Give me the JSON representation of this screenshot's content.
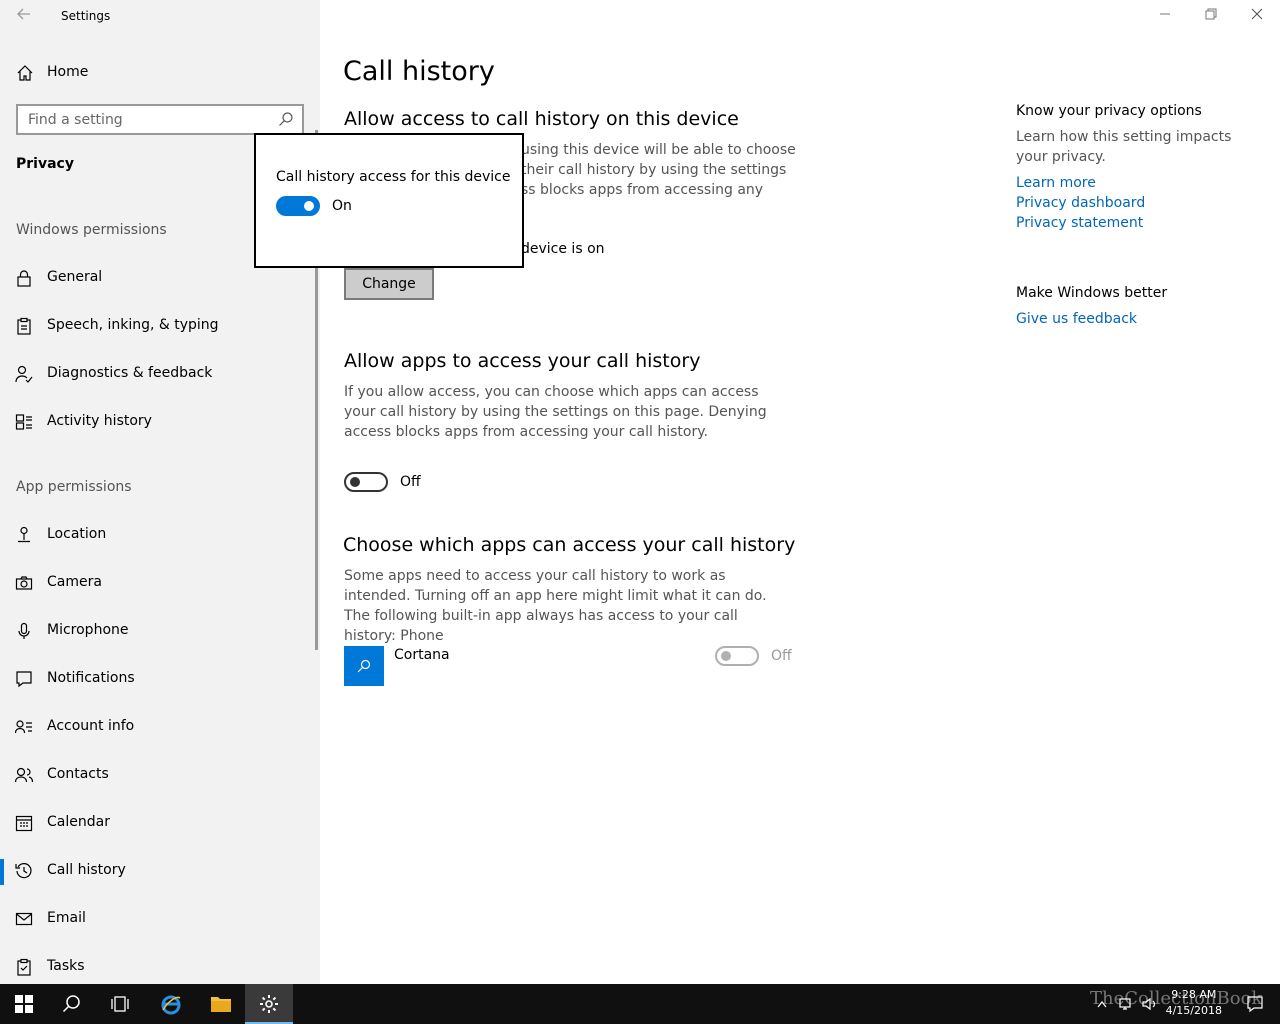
{
  "window": {
    "title": "Settings",
    "back_icon": "back-arrow-icon",
    "controls": [
      "minimize-icon",
      "maximize-icon",
      "close-icon"
    ]
  },
  "sidebar": {
    "home_label": "Home",
    "search_placeholder": "Find a setting",
    "section_title": "Privacy",
    "windows_permissions_label": "Windows permissions",
    "windows_permissions": [
      {
        "label": "General",
        "icon": "lock-icon"
      },
      {
        "label": "Speech, inking, & typing",
        "icon": "clipboard-icon"
      },
      {
        "label": "Diagnostics & feedback",
        "icon": "person-feedback-icon"
      },
      {
        "label": "Activity history",
        "icon": "activity-history-icon"
      }
    ],
    "app_permissions_label": "App permissions",
    "app_permissions": [
      {
        "label": "Location",
        "icon": "location-icon"
      },
      {
        "label": "Camera",
        "icon": "camera-icon"
      },
      {
        "label": "Microphone",
        "icon": "microphone-icon"
      },
      {
        "label": "Notifications",
        "icon": "notification-icon"
      },
      {
        "label": "Account info",
        "icon": "account-info-icon"
      },
      {
        "label": "Contacts",
        "icon": "contacts-icon"
      },
      {
        "label": "Calendar",
        "icon": "calendar-icon"
      },
      {
        "label": "Call history",
        "icon": "call-history-icon",
        "active": true
      },
      {
        "label": "Email",
        "icon": "email-icon"
      },
      {
        "label": "Tasks",
        "icon": "tasks-icon"
      }
    ]
  },
  "main": {
    "page_title": "Call history",
    "section1": {
      "heading": "Allow access to call history on this device",
      "body_visible": [
        "using this device will be able to choose",
        "their call history by using the settings",
        "ss blocks apps from accessing any"
      ],
      "status_visible": "device is on",
      "change_button": "Change"
    },
    "section2": {
      "heading": "Allow apps to access your call history",
      "body": "If you allow access, you can choose which apps can access your call history by using the settings on this page. Denying access blocks apps from accessing your call history.",
      "toggle_state": "Off"
    },
    "section3": {
      "heading": "Choose which apps can access your call history",
      "body": "Some apps need to access your call history to work as intended. Turning off an app here might limit what it can do. The following built-in app always has access to your call history: Phone",
      "apps": [
        {
          "name": "Cortana",
          "toggle_state": "Off",
          "icon": "cortana-search-icon"
        }
      ]
    }
  },
  "right_panel": {
    "privacy_heading": "Know your privacy options",
    "privacy_text": "Learn how this setting impacts your privacy.",
    "links": [
      "Learn more",
      "Privacy dashboard",
      "Privacy statement"
    ],
    "feedback_heading": "Make Windows better",
    "feedback_link": "Give us feedback"
  },
  "popup": {
    "title": "Call history access for this device",
    "toggle_state": "On"
  },
  "taskbar": {
    "time": "9:28 AM",
    "date": "4/15/2018",
    "watermark": "TheCollectionBook",
    "accent": "#0078d7"
  }
}
